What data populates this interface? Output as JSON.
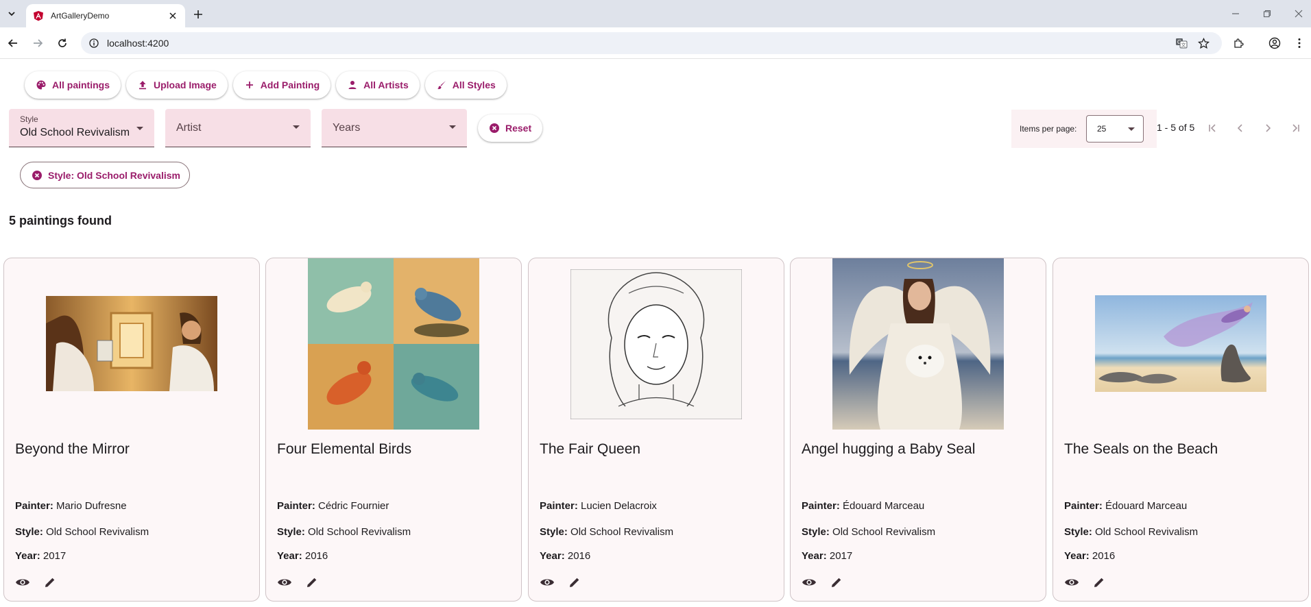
{
  "browser": {
    "tab_title": "ArtGalleryDemo",
    "url": "localhost:4200"
  },
  "nav": {
    "buttons": [
      {
        "label": "All paintings",
        "icon": "palette-icon"
      },
      {
        "label": "Upload Image",
        "icon": "upload-icon"
      },
      {
        "label": "Add Painting",
        "icon": "plus-icon"
      },
      {
        "label": "All Artists",
        "icon": "person-icon"
      },
      {
        "label": "All Styles",
        "icon": "brush-icon"
      }
    ]
  },
  "filters": {
    "style": {
      "label": "Style",
      "value": "Old School Revivalism"
    },
    "artist": {
      "placeholder": "Artist"
    },
    "years": {
      "placeholder": "Years"
    },
    "reset_label": "Reset"
  },
  "pagination": {
    "items_per_page_label": "Items per page:",
    "items_per_page": "25",
    "range": "1 - 5 of 5"
  },
  "active_chip": "Style: Old School Revivalism",
  "results_text": "5 paintings found",
  "labels": {
    "painter": "Painter:",
    "style": "Style:",
    "year": "Year:"
  },
  "paintings": [
    {
      "title": "Beyond the Mirror",
      "painter": "Mario Dufresne",
      "style": "Old School Revivalism",
      "year": "2017"
    },
    {
      "title": "Four Elemental Birds",
      "painter": "Cédric Fournier",
      "style": "Old School Revivalism",
      "year": "2016"
    },
    {
      "title": "The Fair Queen",
      "painter": "Lucien Delacroix",
      "style": "Old School Revivalism",
      "year": "2016"
    },
    {
      "title": "Angel hugging a Baby Seal",
      "painter": "Édouard Marceau",
      "style": "Old School Revivalism",
      "year": "2017"
    },
    {
      "title": "The Seals on the Beach",
      "painter": "Édouard Marceau",
      "style": "Old School Revivalism",
      "year": "2016"
    }
  ],
  "colors": {
    "accent": "#9a1c6a",
    "field_bg": "#f7dfe6",
    "card_bg": "#fdf7f8"
  }
}
